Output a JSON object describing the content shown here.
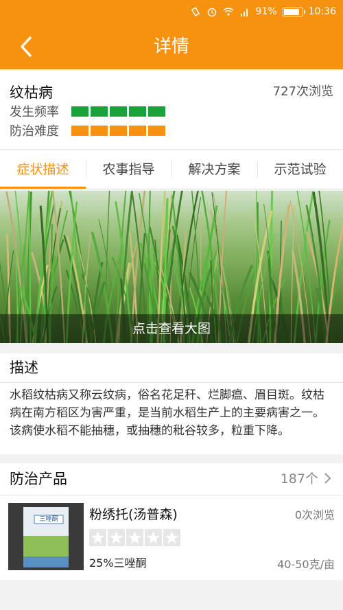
{
  "status": {
    "battery": "91%",
    "time": "10:36"
  },
  "header": {
    "title": "详情"
  },
  "disease": {
    "name": "纹枯病",
    "views": "727次浏览",
    "frequency_label": "发生频率",
    "frequency_level": 5,
    "frequency_color": "#1aa33a",
    "difficulty_label": "防治难度",
    "difficulty_level": 5,
    "difficulty_color": "#f7920f"
  },
  "tabs": [
    "症状描述",
    "农事指导",
    "解决方案",
    "示范试验"
  ],
  "active_tab": 0,
  "photo": {
    "caption": "点击查看大图"
  },
  "description": {
    "heading": "描述",
    "text": "水稻纹枯病又称云纹病，俗名花足秆、烂脚瘟、眉目斑。纹枯病在南方稻区为害严重，是当前水稻生产上的主要病害之一。该病使水稻不能抽穗，或抽穗的秕谷较多，粒重下降。"
  },
  "products": {
    "heading": "防治产品",
    "count": "187个",
    "item": {
      "name": "粉绣托(汤普森)",
      "views": "0次浏览",
      "rating": 0,
      "ingredient": "25%三唑酮",
      "dosage": "40-50克/亩",
      "package_text": "三唑酮"
    }
  },
  "colors": {
    "accent": "#f7920f"
  }
}
